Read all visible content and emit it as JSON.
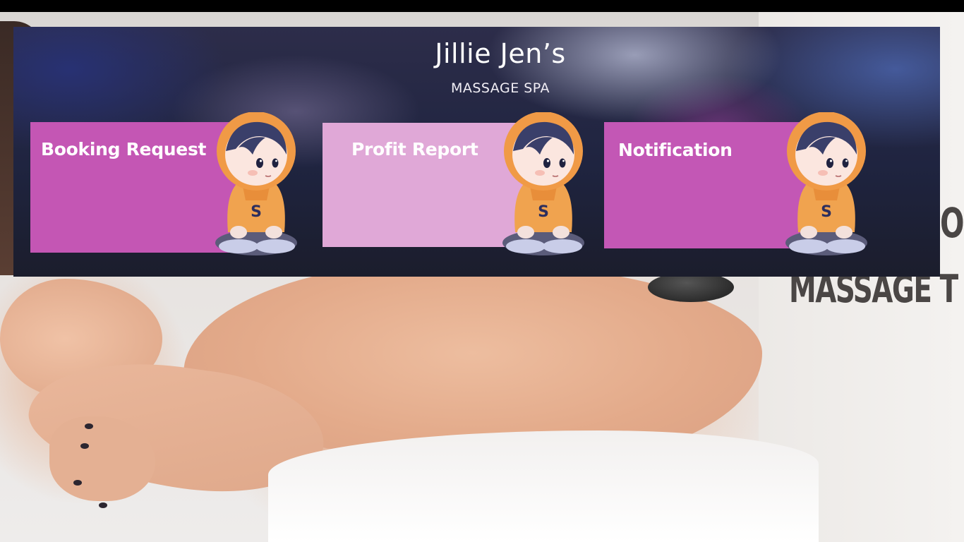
{
  "brand": {
    "title": "Jillie Jen’s",
    "subtitle": "MASSAGE SPA"
  },
  "cards": [
    {
      "label": "Booking Request",
      "color": "#c456b4"
    },
    {
      "label": "Profit Report",
      "color": "#e0a8d7"
    },
    {
      "label": "Notification",
      "color": "#c357b5"
    }
  ],
  "mascot": {
    "icon": "hooded-child-mascot-icon",
    "shirt_letter": "S"
  },
  "background": {
    "text_line_1": "ON",
    "text_line_2": "MASSAGE T"
  }
}
